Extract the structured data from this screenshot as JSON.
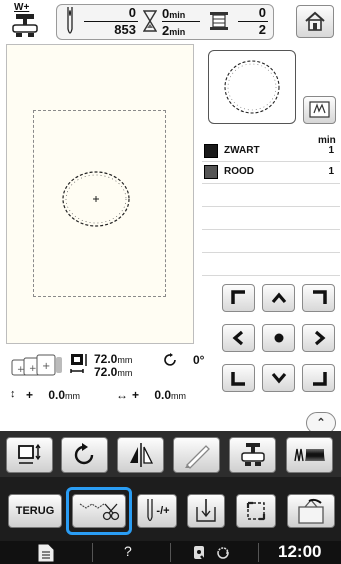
{
  "status_bar": {
    "presser_foot_label": "W+",
    "stitch_current": "0",
    "stitch_total": "853",
    "time_current": "0",
    "time_total": "2",
    "time_unit": "min",
    "color_current": "0",
    "color_total": "2"
  },
  "color_list": {
    "header": "min",
    "items": [
      {
        "name": "ZWART",
        "time": "1",
        "swatch": "#1a1a1a"
      },
      {
        "name": "ROOD",
        "time": "1",
        "swatch": "#555555"
      }
    ]
  },
  "info": {
    "height_value": "72.0",
    "width_value": "72.0",
    "size_unit": "mm",
    "rotation_value": "0°",
    "vertical_offset_prefix": "+",
    "vertical_offset_value": "0.0",
    "horizontal_offset_prefix": "+",
    "horizontal_offset_value": "0.0",
    "offset_unit": "mm"
  },
  "actions": {
    "back_label": "TERUG",
    "thread_adjust_label": "-/+"
  },
  "footer": {
    "help_label": "?",
    "clock": "12:00"
  },
  "colors": {
    "accent_highlight": "#2a9df4",
    "toolbar_bg": "#2d2d2d",
    "footer_bg": "#111111"
  }
}
